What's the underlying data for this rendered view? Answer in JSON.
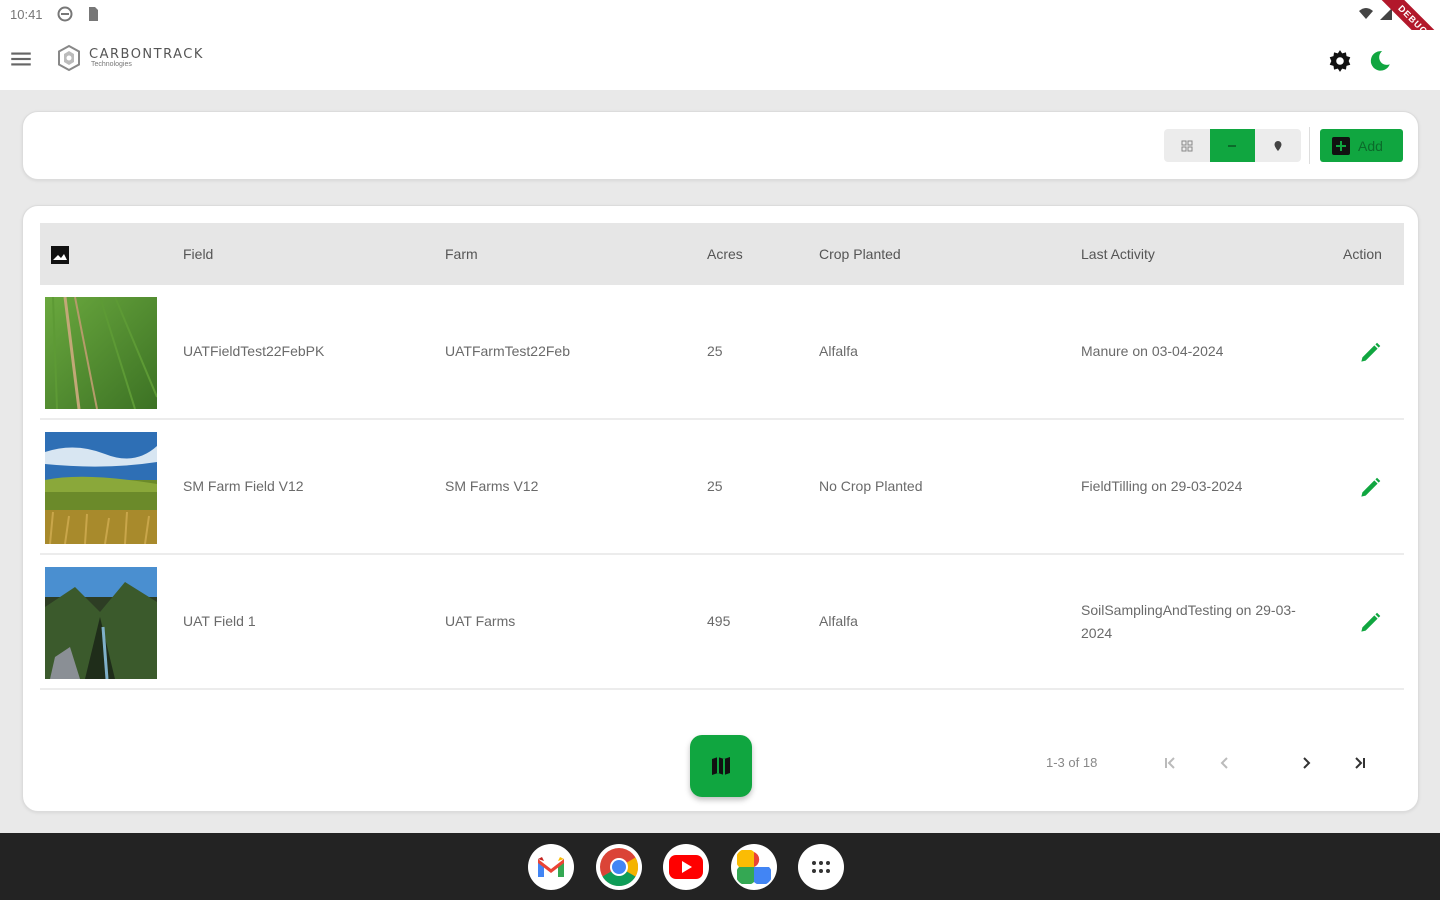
{
  "status_bar": {
    "time": "10:41",
    "debug_label": "DEBUG"
  },
  "app": {
    "brand_name": "CARBONTRACK",
    "brand_sub": "Technologies"
  },
  "toolbar": {
    "view_modes": [
      "grid-view-icon",
      "list-view-icon",
      "map-pin-view-icon"
    ],
    "active_view": "list",
    "add_label": "Add"
  },
  "table": {
    "columns": [
      "Field",
      "Farm",
      "Acres",
      "Crop Planted",
      "Last Activity",
      "Action"
    ],
    "rows": [
      {
        "field": "UATFieldTest22FebPK",
        "farm": "UATFarmTest22Feb",
        "acres": "25",
        "crop": "Alfalfa",
        "activity": "Manure on 03-04-2024"
      },
      {
        "field": "SM Farm Field V12",
        "farm": "SM Farms V12",
        "acres": "25",
        "crop": "No Crop Planted",
        "activity": "FieldTilling on 29-03-2024"
      },
      {
        "field": "UAT Field 1",
        "farm": "UAT Farms",
        "acres": "495",
        "crop": "Alfalfa",
        "activity": "SoilSamplingAndTesting on 29-03-2024"
      }
    ]
  },
  "pagination": {
    "label": "1-3 of 18"
  },
  "dock": {
    "apps": [
      "gmail-icon",
      "chrome-icon",
      "youtube-icon",
      "photos-icon",
      "app-launcher-icon"
    ]
  },
  "colors": {
    "accent": "#10a640",
    "dock": "#232323",
    "background": "#e9e9e9"
  }
}
